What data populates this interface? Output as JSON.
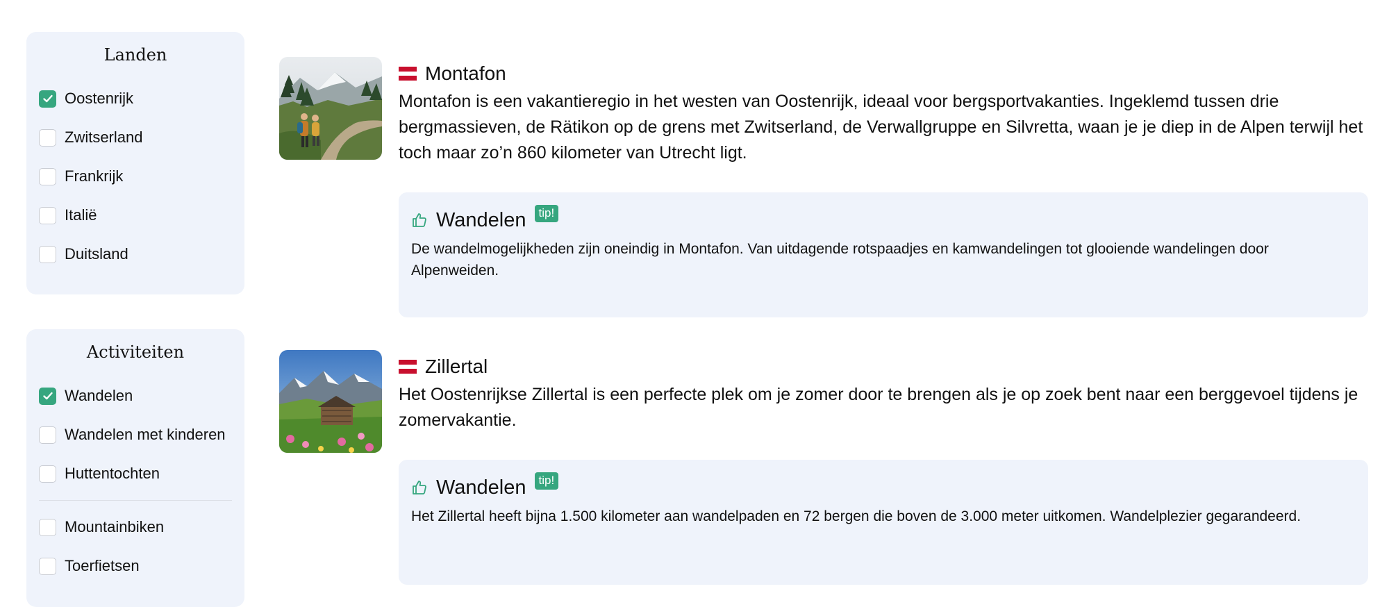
{
  "filters": {
    "landen": {
      "title": "Landen",
      "items": [
        {
          "label": "Oostenrijk",
          "checked": true
        },
        {
          "label": "Zwitserland",
          "checked": false
        },
        {
          "label": "Frankrijk",
          "checked": false
        },
        {
          "label": "Italië",
          "checked": false
        },
        {
          "label": "Duitsland",
          "checked": false
        }
      ]
    },
    "activiteiten": {
      "title": "Activiteiten",
      "items": [
        {
          "label": "Wandelen",
          "checked": true
        },
        {
          "label": "Wandelen met kinderen",
          "checked": false
        },
        {
          "label": "Huttentochten",
          "checked": false
        },
        {
          "label": "Mountainbiken",
          "checked": false
        },
        {
          "label": "Toerfietsen",
          "checked": false
        }
      ]
    }
  },
  "results": [
    {
      "title": "Montafon",
      "flag": "austria-flag-icon",
      "description": "Montafon is een vakantieregio in het westen van Oostenrijk, ideaal voor bergsportvakanties. Ingeklemd tussen drie bergmassieven, de Rätikon op de grens met Zwitserland, de Verwallgruppe en Silvretta, waan je je diep in de Alpen terwijl het toch maar zo’n 860 kilometer van Utrecht ligt.",
      "tip": {
        "icon": "thumbs-up-icon",
        "title": "Wandelen",
        "badge": "tip!",
        "text": "De wandelmogelijkheden zijn oneindig in Montafon. Van uitdagende rotspaadjes en kamwandelingen tot glooiende wandelingen door Alpenweiden."
      }
    },
    {
      "title": "Zillertal",
      "flag": "austria-flag-icon",
      "description": "Het Oostenrijkse Zillertal is een perfecte plek om je zomer door te brengen als je op zoek bent naar een berggevoel tijdens je zomervakantie.",
      "tip": {
        "icon": "thumbs-up-icon",
        "title": "Wandelen",
        "badge": "tip!",
        "text": "Het Zillertal heeft bijna 1.500 kilometer aan wandelpaden en 72 bergen die boven de 3.000 meter uitkomen. Wandelplezier gegarandeerd."
      }
    }
  ],
  "colors": {
    "accent": "#36a67f",
    "card_bg": "#eff3fb",
    "flag_red": "#c8102e"
  }
}
